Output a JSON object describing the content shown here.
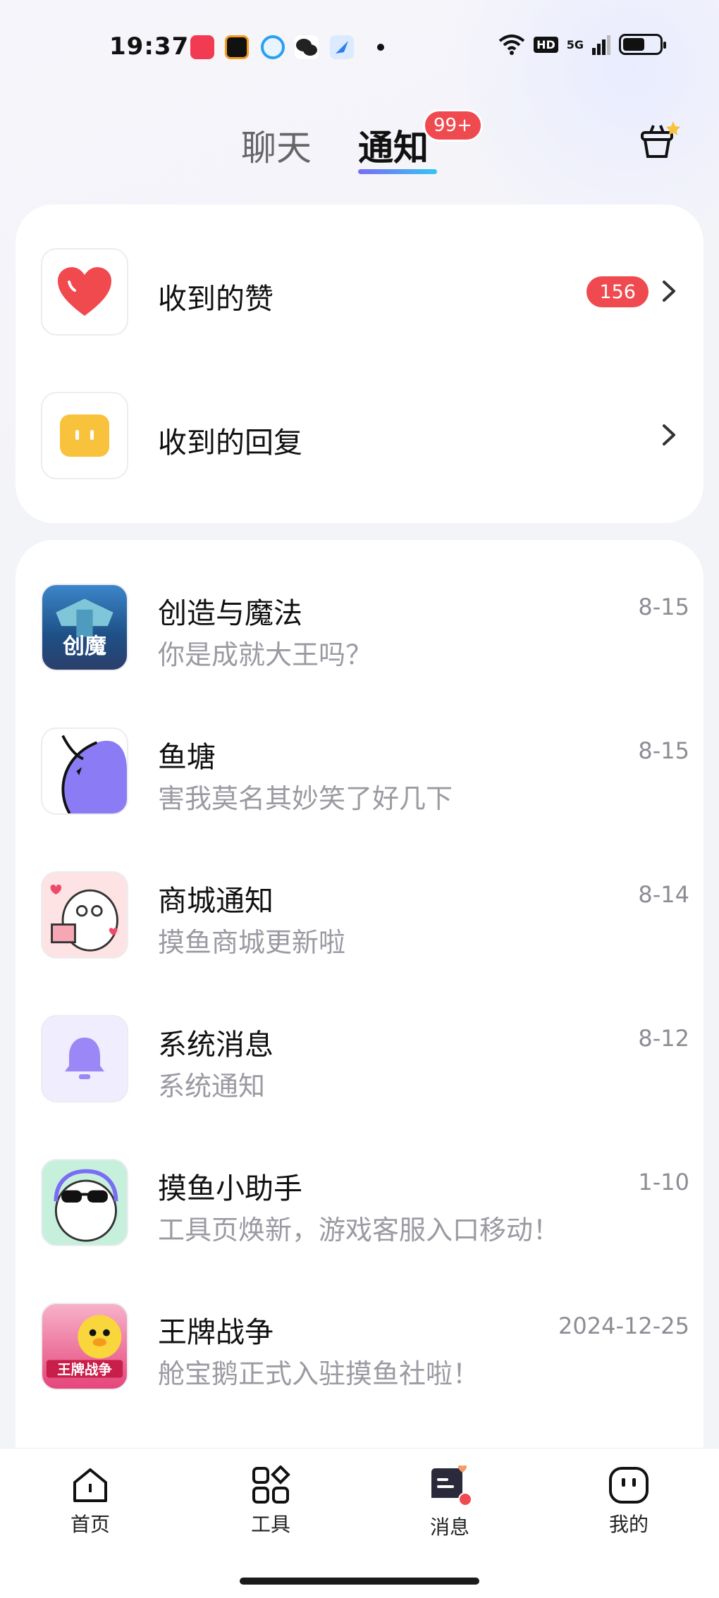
{
  "status_bar": {
    "time": "19:37",
    "network": "5G",
    "hd": "HD"
  },
  "header": {
    "tabs": [
      {
        "label": "聊天",
        "active": false
      },
      {
        "label": "通知",
        "active": true
      }
    ],
    "notice_badge": "99+"
  },
  "interaction_items": [
    {
      "label": "收到的赞",
      "badge": "156",
      "icon": "heart-icon"
    },
    {
      "label": "收到的回复",
      "badge": "",
      "icon": "reply-face-icon"
    }
  ],
  "messages": [
    {
      "title": "创造与魔法",
      "subtitle": "你是成就大王吗？",
      "date": "8-15",
      "avatar": "game-cover-chuangmo"
    },
    {
      "title": "鱼塘",
      "subtitle": "害我莫名其妙笑了好几下",
      "date": "8-15",
      "avatar": "fish-icon"
    },
    {
      "title": "商城通知",
      "subtitle": "摸鱼商城更新啦",
      "date": "8-14",
      "avatar": "mascot-gift"
    },
    {
      "title": "系统消息",
      "subtitle": "系统通知",
      "date": "8-12",
      "avatar": "bell-icon"
    },
    {
      "title": "摸鱼小助手",
      "subtitle": "工具页焕新，游戏客服入口移动！",
      "date": "1-10",
      "avatar": "mascot-sunglasses"
    },
    {
      "title": "王牌战争",
      "subtitle": "舱宝鹅正式入驻摸鱼社啦！",
      "date": "2024-12-25",
      "avatar": "game-cover-wangpai"
    }
  ],
  "bottom_nav": [
    {
      "label": "首页",
      "icon": "home-icon",
      "active": false
    },
    {
      "label": "工具",
      "icon": "grid-icon",
      "active": false
    },
    {
      "label": "消息",
      "icon": "message-icon",
      "active": true
    },
    {
      "label": "我的",
      "icon": "profile-face-icon",
      "active": false
    }
  ],
  "colors": {
    "accent_red": "#ef4a4f",
    "tab_gradient_start": "#7a6cf5",
    "tab_gradient_end": "#35c6f1",
    "bell_purple": "#9b87f5"
  }
}
